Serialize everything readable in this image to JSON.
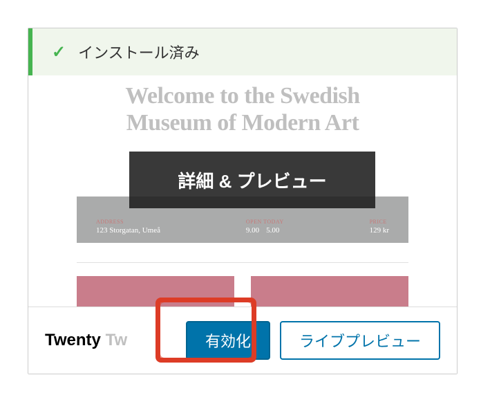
{
  "status": {
    "message": "インストール済み"
  },
  "preview": {
    "hero_line1": "Welcome to the Swedish",
    "hero_line2": "Museum of Modern Art",
    "overlay_label": "詳細 & プレビュー",
    "info": {
      "address_label": "ADDRESS",
      "address_value": "123 Storgatan, Umeå",
      "open_label": "OPEN TODAY",
      "open_from": "9.00",
      "open_to": "5.00",
      "price_label": "PRICE",
      "price_value": "129 kr"
    }
  },
  "actions": {
    "theme_name_prefix": "Twenty",
    "theme_name_rest": "Tw",
    "activate_label": "有効化",
    "live_preview_label": "ライブプレビュー"
  }
}
